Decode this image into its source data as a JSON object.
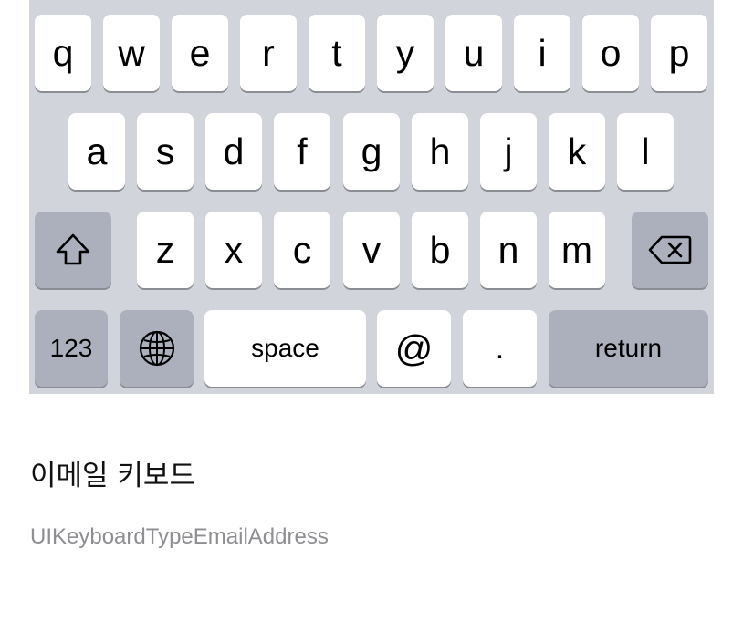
{
  "keyboard": {
    "row1": [
      "q",
      "w",
      "e",
      "r",
      "t",
      "y",
      "u",
      "i",
      "o",
      "p"
    ],
    "row2": [
      "a",
      "s",
      "d",
      "f",
      "g",
      "h",
      "j",
      "k",
      "l"
    ],
    "row3": [
      "z",
      "x",
      "c",
      "v",
      "b",
      "n",
      "m"
    ],
    "shift_icon": "shift-icon",
    "delete_icon": "delete-backspace-icon",
    "numbers_label": "123",
    "globe_icon": "globe-icon",
    "space_label": "space",
    "at_label": "@",
    "period_label": ".",
    "return_label": "return"
  },
  "caption": {
    "title": "이메일 키보드",
    "subtitle": "UIKeyboardTypeEmailAddress"
  },
  "colors": {
    "keyboard_background": "#d1d5db",
    "key_light": "#ffffff",
    "key_dark": "#abb0bc",
    "subtitle": "#8e8e93"
  }
}
